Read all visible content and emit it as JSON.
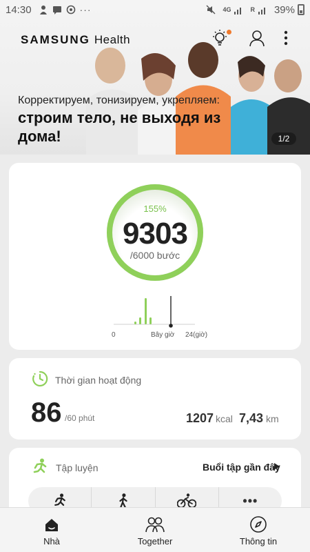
{
  "status_bar": {
    "time": "14:30",
    "more": "···",
    "network": "4G",
    "roaming": "R",
    "battery_percent": "39%"
  },
  "hero": {
    "brand_primary": "SAMSUNG",
    "brand_secondary": "Health",
    "subtitle": "Корректируем, тонизируем, укрепляем:",
    "title": "строим тело, не выходя из дома!",
    "pager": "1/2"
  },
  "steps": {
    "percent": "155%",
    "count": "9303",
    "goal": "/6000 bước",
    "progress_fraction": 1.0,
    "accent": "#8fd05a",
    "chart": {
      "type": "bar",
      "tick_start": "0",
      "tick_now": "Bây giờ",
      "tick_end": "24(giờ)",
      "bar_color": "#8fd05a"
    }
  },
  "activity": {
    "title": "Thời gian hoạt động",
    "minutes": "86",
    "minutes_goal": "/60 phút",
    "kcal": "1207",
    "kcal_unit": "kcal",
    "distance": "7,43",
    "distance_unit": "km"
  },
  "workout": {
    "title": "Tập luyện",
    "recent": "Buổi tập gần đây",
    "buttons": [
      {
        "icon": "running-icon"
      },
      {
        "icon": "walking-icon"
      },
      {
        "icon": "cycling-icon"
      },
      {
        "icon": "more-icon",
        "label": "•••"
      }
    ]
  },
  "bottom_nav": [
    {
      "label": "Nhà",
      "icon": "home-icon"
    },
    {
      "label": "Together",
      "icon": "together-icon"
    },
    {
      "label": "Thông tin",
      "icon": "compass-icon"
    }
  ],
  "colors": {
    "accent": "#8fd05a",
    "notification": "#f07a2d"
  }
}
